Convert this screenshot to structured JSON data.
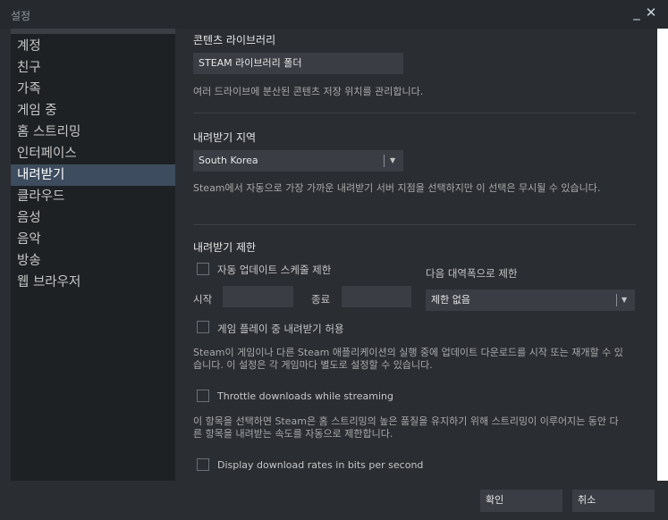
{
  "window": {
    "title": "설정",
    "minimize_glyph": "_",
    "close_glyph": "✕"
  },
  "sidebar": {
    "items": [
      {
        "label": "계정"
      },
      {
        "label": "친구"
      },
      {
        "label": "가족"
      },
      {
        "label": "게임 중"
      },
      {
        "label": "홈 스트리밍"
      },
      {
        "label": "인터페이스"
      },
      {
        "label": "내려받기",
        "active": true
      },
      {
        "label": "클라우드"
      },
      {
        "label": "음성"
      },
      {
        "label": "음악"
      },
      {
        "label": "방송"
      },
      {
        "label": "웹 브라우저"
      }
    ]
  },
  "content_library": {
    "heading": "콘텐츠 라이브러리",
    "folder_button": "STEAM 라이브러리 폴더",
    "description": "여러 드라이브에 분산된 콘텐츠 저장 위치를 관리합니다."
  },
  "download_region": {
    "heading": "내려받기 지역",
    "selected": "South Korea",
    "description": "Steam에서 자동으로 가장 가까운 내려받기 서버 지점을 선택하지만 이 선택은 무시될 수 있습니다."
  },
  "download_limits": {
    "heading": "내려받기 제한",
    "auto_update_label": "자동 업데이트 스케줄 제한",
    "start_label": "시작",
    "end_label": "종료",
    "bandwidth_label": "다음 대역폭으로 제한",
    "bandwidth_selected": "제한 없음",
    "allow_during_play_label": "게임 플레이 중 내려받기 허용",
    "allow_during_play_desc": "Steam이 게임이나 다른 Steam 애플리케이션의 실행 중에 업데이트 다운로드를 시작 또는 재개할 수 있습니다. 이 설정은 각 게임마다 별도로 설정할 수 있습니다.",
    "throttle_label": "Throttle downloads while streaming",
    "throttle_desc": "이 항목을 선택하면 Steam은 홈 스트리밍의 높은 품질을 유지하기 위해 스트리밍이 이루어지는 동안 다른 항목을 내려받는 속도를 자동으로 제한합니다.",
    "bits_label": "Display download rates in bits per second"
  },
  "footer": {
    "ok": "확인",
    "cancel": "취소"
  },
  "icons": {
    "dropdown": "chevron-down-icon",
    "check": "checkbox"
  }
}
